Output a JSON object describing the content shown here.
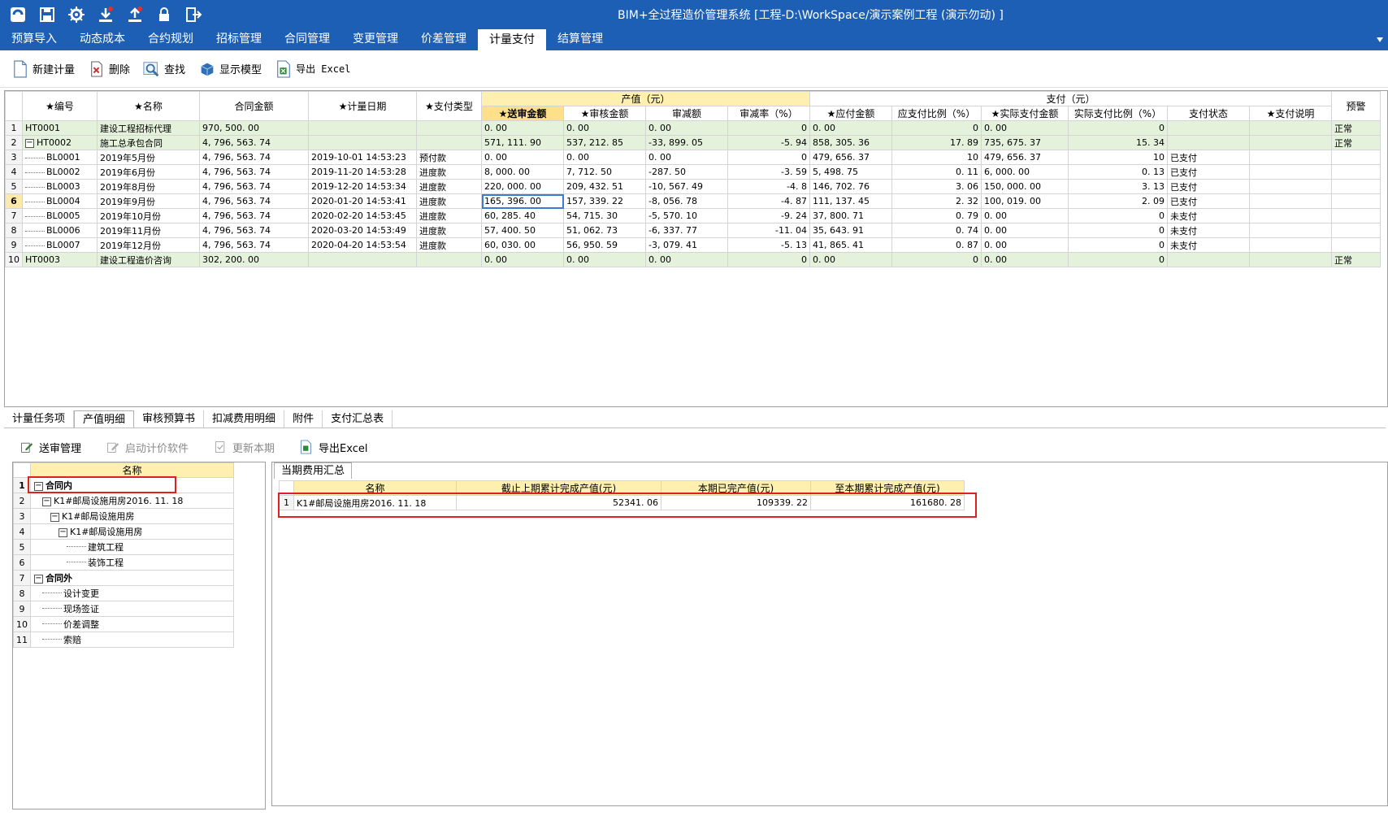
{
  "window": {
    "title": "BIM+全过程造价管理系统 [工程-D:\\WorkSpace/演示案例工程 (演示勿动) ]"
  },
  "quick_access": [
    "app-logo-icon",
    "save-icon",
    "settings-icon",
    "download-icon",
    "upload-icon",
    "lock-icon",
    "exit-icon"
  ],
  "menu": {
    "items": [
      "预算导入",
      "动态成本",
      "合约规划",
      "招标管理",
      "合同管理",
      "变更管理",
      "价差管理",
      "计量支付",
      "结算管理"
    ],
    "active_index": 7
  },
  "toolbar": {
    "new_measure": "新建计量",
    "delete": "删除",
    "find": "查找",
    "show_model": "显示模型",
    "export_excel": "导出 Excel"
  },
  "main_grid": {
    "group_headers": {
      "output_value": "产值（元）",
      "payment": "支付（元）"
    },
    "headers": {
      "code": "★编号",
      "name": "★名称",
      "contract_amount": "合同金额",
      "measure_date": "★计量日期",
      "pay_type": "★支付类型",
      "submit_amount": "★送审金额",
      "audit_amount": "★审核金额",
      "audit_reduce": "审减额",
      "audit_reduce_rate": "审减率（%）",
      "payable_amount": "★应付金额",
      "payable_ratio": "应支付比例（%）",
      "actual_paid": "★实际支付金额",
      "actual_ratio": "实际支付比例（%）",
      "pay_status": "支付状态",
      "pay_note": "★支付说明",
      "warning": "预警"
    },
    "rows": [
      {
        "rn": "1",
        "code": "HT0001",
        "name": "建设工程招标代理",
        "contract": "970, 500. 00",
        "date": "",
        "type": "",
        "submit": "0. 00",
        "audit": "0. 00",
        "reduce": "0. 00",
        "rate": "0",
        "payable": "0. 00",
        "pratio": "0",
        "actual": "0. 00",
        "aratio": "0",
        "status": "",
        "note": "",
        "warn": "正常"
      },
      {
        "rn": "2",
        "code": "HT0002",
        "name": "施工总承包合同",
        "contract": "4, 796, 563. 74",
        "date": "",
        "type": "",
        "submit": "571, 111. 90",
        "audit": "537, 212. 85",
        "reduce": "-33, 899. 05",
        "rate": "-5. 94",
        "payable": "858, 305. 36",
        "pratio": "17. 89",
        "actual": "735, 675. 37",
        "aratio": "15. 34",
        "status": "",
        "note": "",
        "warn": "正常"
      },
      {
        "rn": "3",
        "code": "BL0001",
        "name": "2019年5月份",
        "contract": "4, 796, 563. 74",
        "date": "2019-10-01  14:53:23",
        "type": "预付款",
        "submit": "0. 00",
        "audit": "0. 00",
        "reduce": "0. 00",
        "rate": "0",
        "payable": "479, 656. 37",
        "pratio": "10",
        "actual": "479, 656. 37",
        "aratio": "10",
        "status": "已支付",
        "note": "",
        "warn": ""
      },
      {
        "rn": "4",
        "code": "BL0002",
        "name": "2019年6月份",
        "contract": "4, 796, 563. 74",
        "date": "2019-11-20  14:53:28",
        "type": "进度款",
        "submit": "8, 000. 00",
        "audit": "7, 712. 50",
        "reduce": "-287. 50",
        "rate": "-3. 59",
        "payable": "5, 498. 75",
        "pratio": "0. 11",
        "actual": "6, 000. 00",
        "aratio": "0. 13",
        "status": "已支付",
        "note": "",
        "warn": ""
      },
      {
        "rn": "5",
        "code": "BL0003",
        "name": "2019年8月份",
        "contract": "4, 796, 563. 74",
        "date": "2019-12-20  14:53:34",
        "type": "进度款",
        "submit": "220, 000. 00",
        "audit": "209, 432. 51",
        "reduce": "-10, 567. 49",
        "rate": "-4. 8",
        "payable": "146, 702. 76",
        "pratio": "3. 06",
        "actual": "150, 000. 00",
        "aratio": "3. 13",
        "status": "已支付",
        "note": "",
        "warn": ""
      },
      {
        "rn": "6",
        "code": "BL0004",
        "name": "2019年9月份",
        "contract": "4, 796, 563. 74",
        "date": "2020-01-20  14:53:41",
        "type": "进度款",
        "submit": "165, 396. 00",
        "audit": "157, 339. 22",
        "reduce": "-8, 056. 78",
        "rate": "-4. 87",
        "payable": "111, 137. 45",
        "pratio": "2. 32",
        "actual": "100, 019. 00",
        "aratio": "2. 09",
        "status": "已支付",
        "note": "",
        "warn": ""
      },
      {
        "rn": "7",
        "code": "BL0005",
        "name": "2019年10月份",
        "contract": "4, 796, 563. 74",
        "date": "2020-02-20  14:53:45",
        "type": "进度款",
        "submit": "60, 285. 40",
        "audit": "54, 715. 30",
        "reduce": "-5, 570. 10",
        "rate": "-9. 24",
        "payable": "37, 800. 71",
        "pratio": "0. 79",
        "actual": "0. 00",
        "aratio": "0",
        "status": "未支付",
        "note": "",
        "warn": ""
      },
      {
        "rn": "8",
        "code": "BL0006",
        "name": "2019年11月份",
        "contract": "4, 796, 563. 74",
        "date": "2020-03-20  14:53:49",
        "type": "进度款",
        "submit": "57, 400. 50",
        "audit": "51, 062. 73",
        "reduce": "-6, 337. 77",
        "rate": "-11. 04",
        "payable": "35, 643. 91",
        "pratio": "0. 74",
        "actual": "0. 00",
        "aratio": "0",
        "status": "未支付",
        "note": "",
        "warn": ""
      },
      {
        "rn": "9",
        "code": "BL0007",
        "name": "2019年12月份",
        "contract": "4, 796, 563. 74",
        "date": "2020-04-20  14:53:54",
        "type": "进度款",
        "submit": "60, 030. 00",
        "audit": "56, 950. 59",
        "reduce": "-3, 079. 41",
        "rate": "-5. 13",
        "payable": "41, 865. 41",
        "pratio": "0. 87",
        "actual": "0. 00",
        "aratio": "0",
        "status": "未支付",
        "note": "",
        "warn": ""
      },
      {
        "rn": "10",
        "code": "HT0003",
        "name": "建设工程造价咨询",
        "contract": "302, 200. 00",
        "date": "",
        "type": "",
        "submit": "0. 00",
        "audit": "0. 00",
        "reduce": "0. 00",
        "rate": "0",
        "payable": "0. 00",
        "pratio": "0",
        "actual": "0. 00",
        "aratio": "0",
        "status": "",
        "note": "",
        "warn": "正常"
      }
    ],
    "current_row": "6"
  },
  "bottom_tabs": {
    "items": [
      "计量任务项",
      "产值明细",
      "审核预算书",
      "扣减费用明细",
      "附件",
      "支付汇总表"
    ],
    "active_index": 1
  },
  "bottom_toolbar": {
    "submit_manage": "送审管理",
    "launch_software": "启动计价软件",
    "update_period": "更新本期",
    "export_excel": "导出Excel"
  },
  "tree": {
    "header": "名称",
    "rows": [
      {
        "rn": "1",
        "label": "合同内",
        "level": 0,
        "toggle": "−",
        "bold": true
      },
      {
        "rn": "2",
        "label": "K1#邮局设施用房2016. 11. 18",
        "level": 1,
        "toggle": "−",
        "bold": false
      },
      {
        "rn": "3",
        "label": "K1#邮局设施用房",
        "level": 2,
        "toggle": "−",
        "bold": false
      },
      {
        "rn": "4",
        "label": "K1#邮局设施用房",
        "level": 3,
        "toggle": "−",
        "bold": false
      },
      {
        "rn": "5",
        "label": "建筑工程",
        "level": 4,
        "toggle": "",
        "bold": false
      },
      {
        "rn": "6",
        "label": "装饰工程",
        "level": 4,
        "toggle": "",
        "bold": false
      },
      {
        "rn": "7",
        "label": "合同外",
        "level": 0,
        "toggle": "−",
        "bold": true
      },
      {
        "rn": "8",
        "label": "设计变更",
        "level": 1,
        "toggle": "",
        "bold": false
      },
      {
        "rn": "9",
        "label": "现场签证",
        "level": 1,
        "toggle": "",
        "bold": false
      },
      {
        "rn": "10",
        "label": "价差调整",
        "level": 1,
        "toggle": "",
        "bold": false
      },
      {
        "rn": "11",
        "label": "索赔",
        "level": 1,
        "toggle": "",
        "bold": false
      }
    ]
  },
  "summary": {
    "tab": "当期费用汇总",
    "headers": {
      "name": "名称",
      "prev_cum": "截止上期累计完成产值(元)",
      "curr": "本期已完产值(元)",
      "to_date": "至本期累计完成产值(元)"
    },
    "rows": [
      {
        "rn": "1",
        "name": "K1#邮局设施用房2016. 11. 18",
        "prev_cum": "52341. 06",
        "curr": "109339. 22",
        "to_date": "161680. 28"
      }
    ]
  },
  "colors": {
    "title_bar": "#1c5fb4",
    "group_row": "#e4f2dc",
    "header_highlight": "#fff0b0",
    "annotation_red": "#e02020"
  }
}
